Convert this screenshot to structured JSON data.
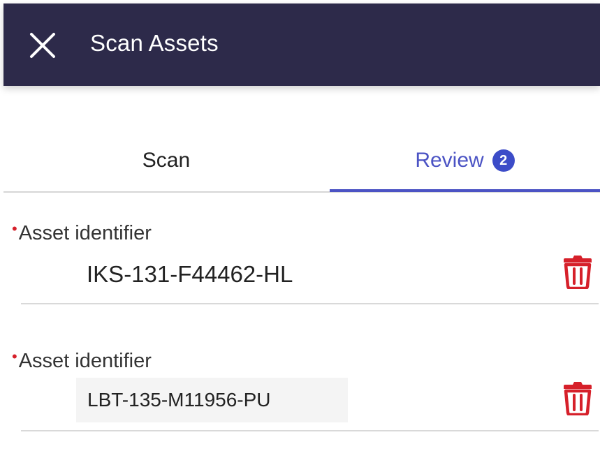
{
  "header": {
    "title": "Scan Assets",
    "close_icon": "close-icon",
    "background": "#2d2a4a"
  },
  "tabs": [
    {
      "label": "Scan",
      "active": false
    },
    {
      "label": "Review",
      "active": true,
      "badge": "2"
    }
  ],
  "accent_color": "#4b53c4",
  "assets": [
    {
      "label": "Asset identifier",
      "required_marker": "•",
      "value": "IKS-131-F44462-HL",
      "delete_icon": "trash-icon"
    },
    {
      "label": "Asset identifier",
      "required_marker": "•",
      "value": "LBT-135-M11956-PU",
      "delete_icon": "trash-icon"
    }
  ],
  "delete_color": "#d6202a"
}
